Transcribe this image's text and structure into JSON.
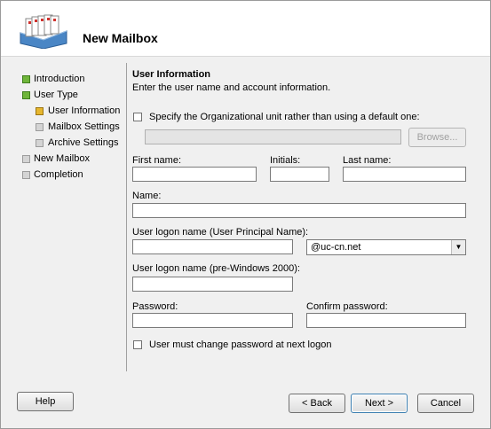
{
  "window": {
    "title": "New Mailbox"
  },
  "nav": {
    "items": [
      {
        "label": "Introduction",
        "state": "complete"
      },
      {
        "label": "User Type",
        "state": "complete"
      },
      {
        "label": "User Information",
        "state": "current"
      },
      {
        "label": "Mailbox Settings",
        "state": "pending"
      },
      {
        "label": "Archive Settings",
        "state": "pending"
      },
      {
        "label": "New Mailbox",
        "state": "pending"
      },
      {
        "label": "Completion",
        "state": "pending"
      }
    ]
  },
  "form": {
    "section_title": "User Information",
    "section_desc": "Enter the user name and account information.",
    "ou_checkbox_label": "Specify the Organizational unit rather than using a default one:",
    "ou_value": "",
    "browse_label": "Browse...",
    "first_name_label": "First name:",
    "first_name_value": "",
    "initials_label": "Initials:",
    "initials_value": "",
    "last_name_label": "Last name:",
    "last_name_value": "",
    "name_label": "Name:",
    "name_value": "",
    "upn_label": "User logon name (User Principal Name):",
    "upn_value": "",
    "domain_value": "@uc-cn.net",
    "pre2000_label": "User logon name (pre-Windows 2000):",
    "pre2000_value": "",
    "password_label": "Password:",
    "password_value": "",
    "confirm_label": "Confirm password:",
    "confirm_value": "",
    "change_pw_label": "User must change password at next logon"
  },
  "footer": {
    "help": "Help",
    "back": "< Back",
    "next": "Next >",
    "cancel": "Cancel"
  },
  "colors": {
    "complete": "#6fb53a",
    "current": "#e6b62e",
    "pending": "#d4d4d4"
  }
}
